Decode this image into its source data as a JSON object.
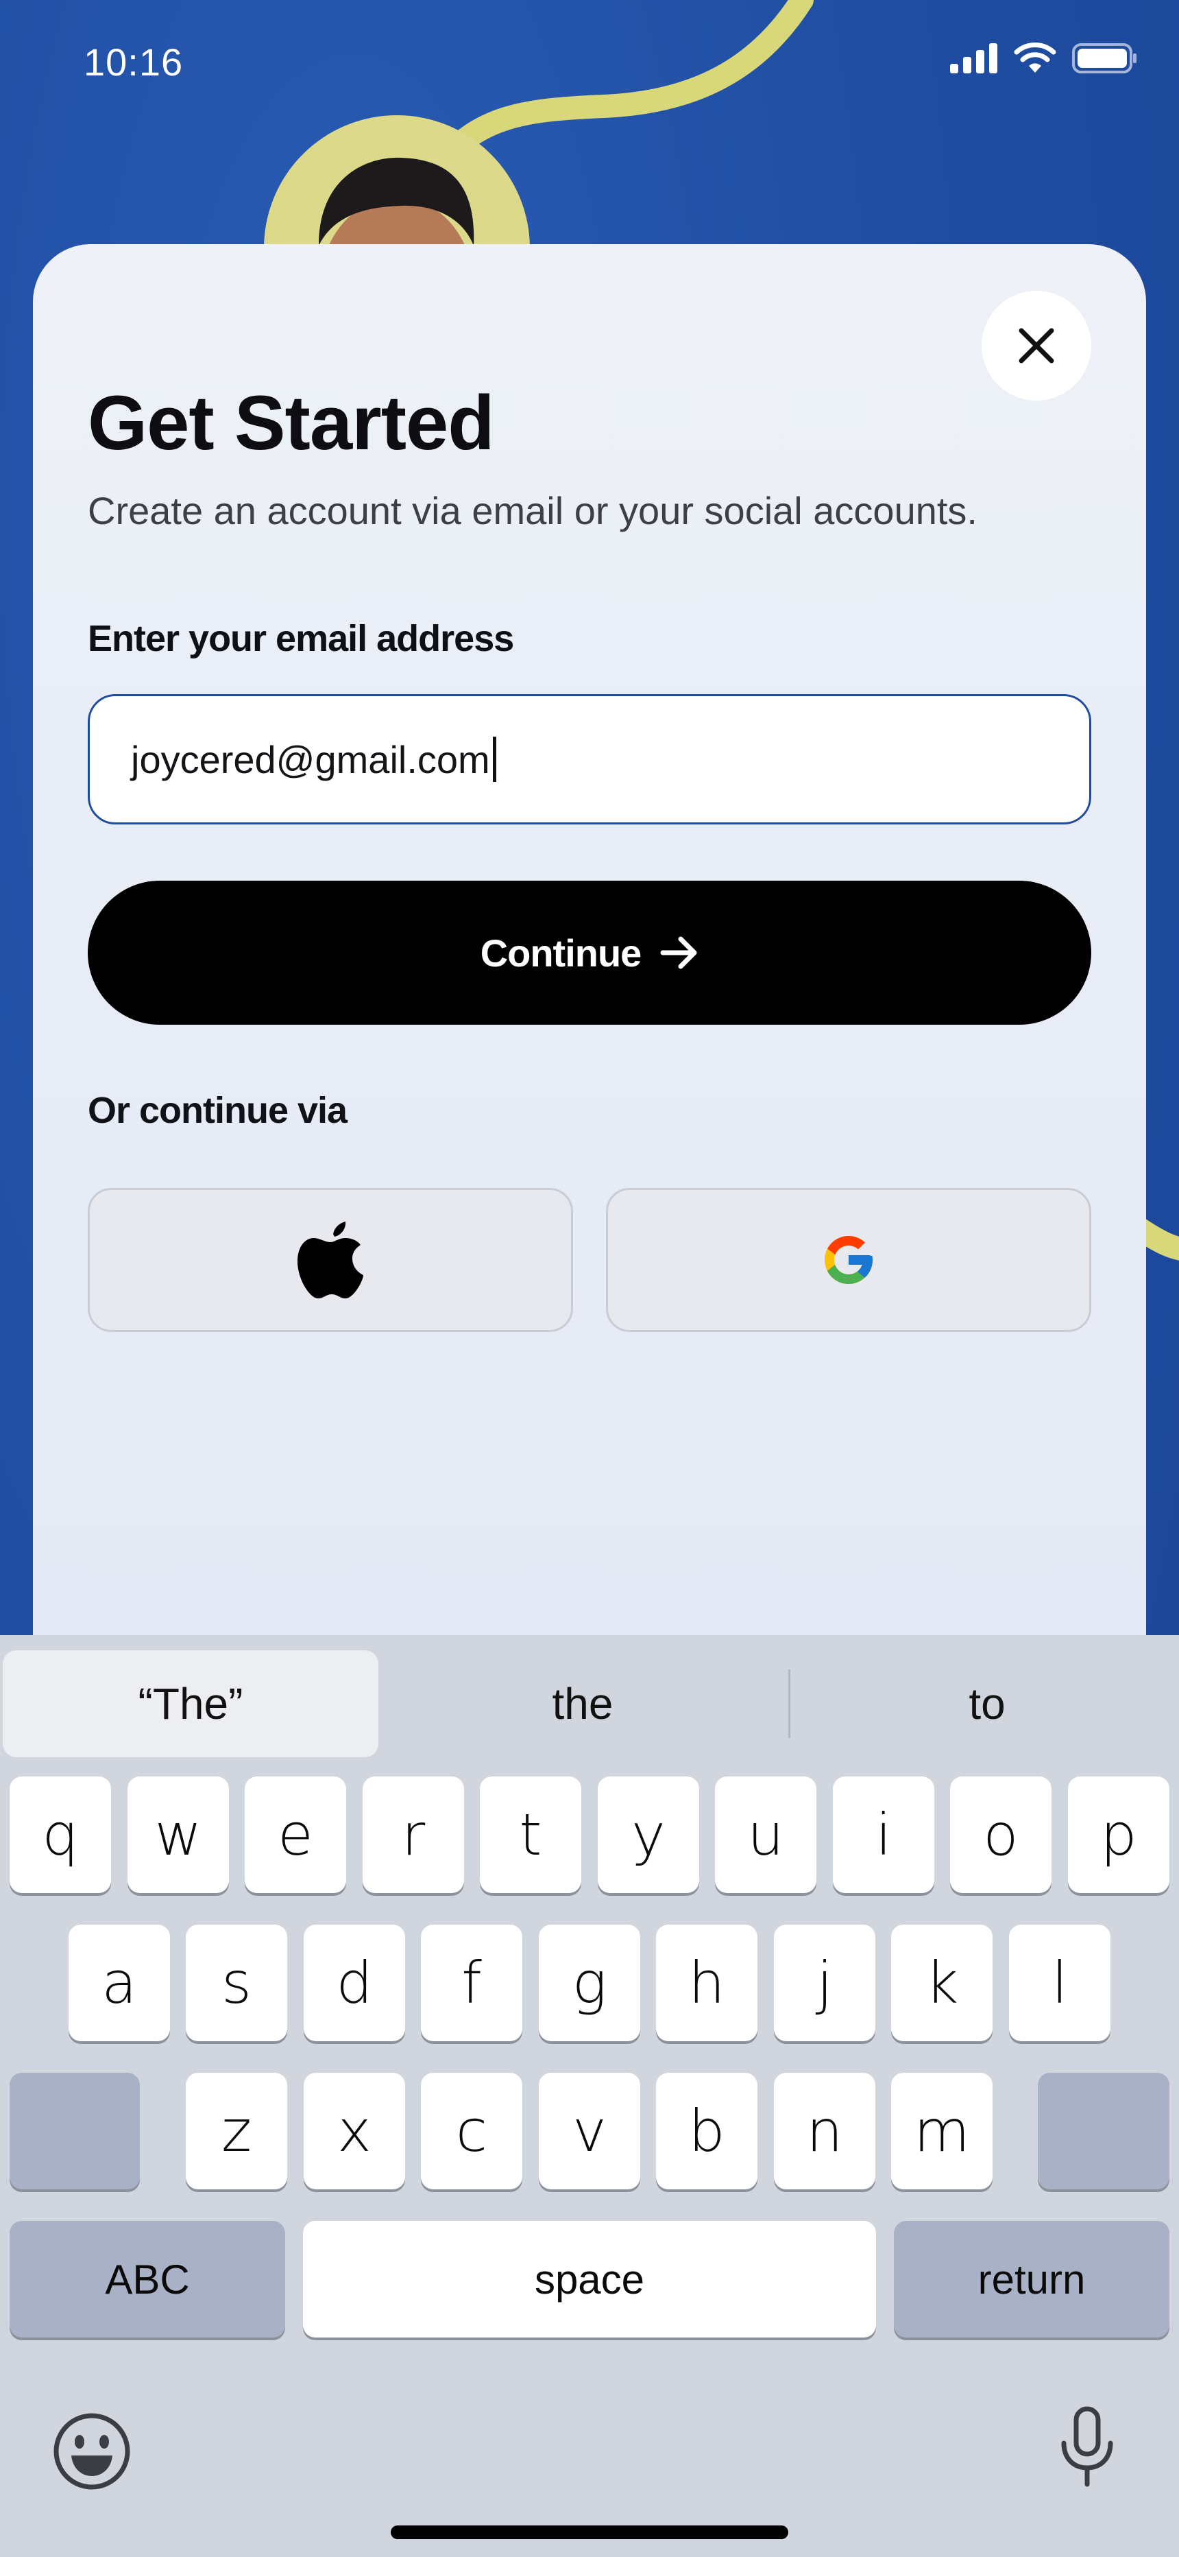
{
  "status_bar": {
    "time": "10:16"
  },
  "sheet": {
    "title": "Get Started",
    "subtitle": "Create an account via email or your social accounts.",
    "email_label": "Enter your email address",
    "email_value": "joycered@gmail.com",
    "continue_label": "Continue",
    "or_label": "Or continue via"
  },
  "keyboard": {
    "suggestions": [
      "“The”",
      "the",
      "to"
    ],
    "row1": [
      "q",
      "w",
      "e",
      "r",
      "t",
      "y",
      "u",
      "i",
      "o",
      "p"
    ],
    "row2": [
      "a",
      "s",
      "d",
      "f",
      "g",
      "h",
      "j",
      "k",
      "l"
    ],
    "row3": [
      "z",
      "x",
      "c",
      "v",
      "b",
      "n",
      "m"
    ],
    "abc_label": "ABC",
    "space_label": "space",
    "return_label": "return"
  },
  "colors": {
    "background": "#2150a6",
    "accent_curve": "#d8d77a",
    "button": "#000000"
  }
}
